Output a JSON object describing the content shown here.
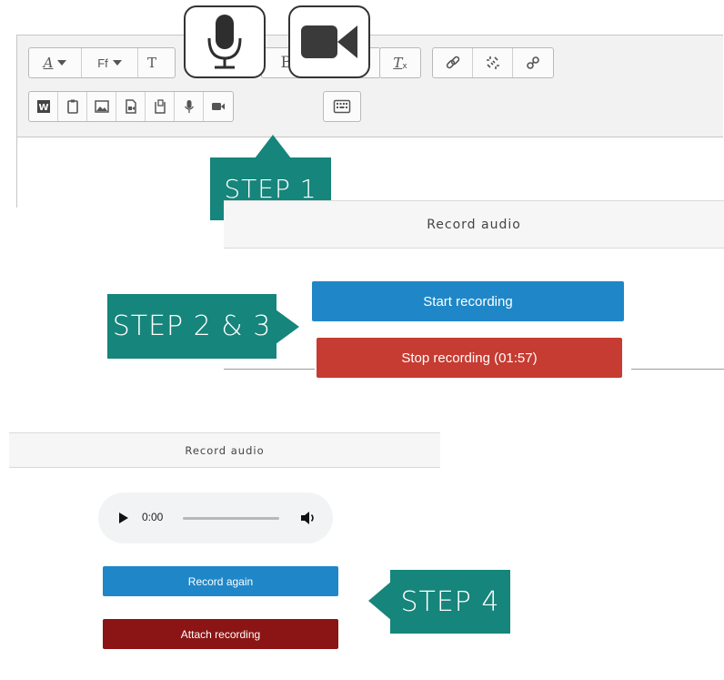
{
  "editor": {
    "toolbar_row1": {
      "font_size_glyph": "A",
      "font_family_glyph": "Ff",
      "text_style_glyph": "T",
      "bold_glyph": "B",
      "clear_format_glyph": "T"
    }
  },
  "callouts": {
    "step1": "STEP 1",
    "step2_3": "STEP 2 & 3",
    "step4": "STEP 4"
  },
  "record_panel": {
    "title": "Record audio",
    "start_label": "Start recording",
    "stop_label": "Stop recording (01:57)"
  },
  "playback_panel": {
    "title": "Record audio",
    "player_time": "0:00",
    "record_again_label": "Record again",
    "attach_label": "Attach recording"
  },
  "colors": {
    "teal": "#16857b",
    "blue": "#1f87c7",
    "red": "#c63b32",
    "dark_red": "#8b1515"
  }
}
